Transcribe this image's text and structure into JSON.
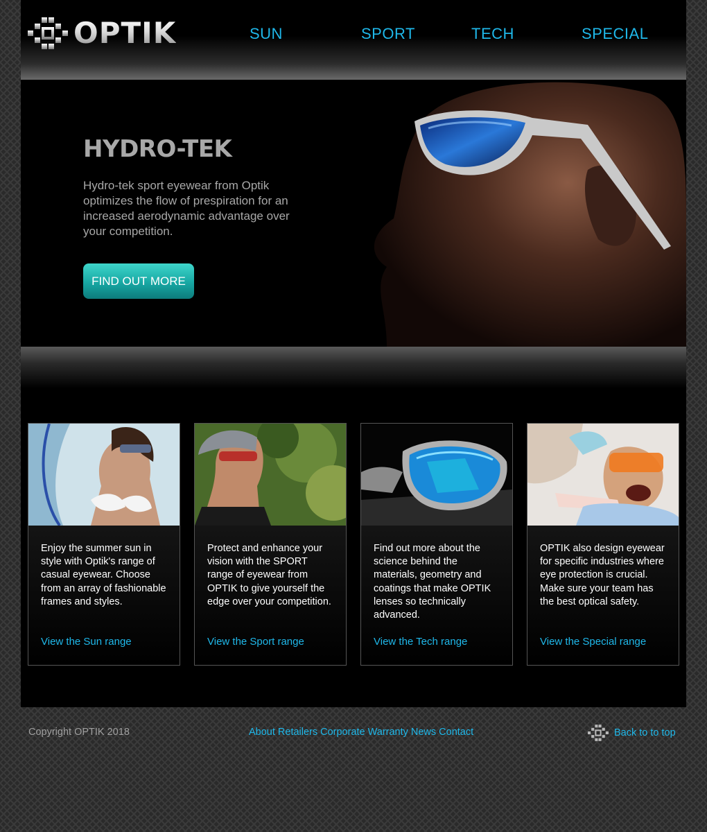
{
  "brand": {
    "name": "OPTIK",
    "logo_icon": "optik-logo-mark"
  },
  "nav": [
    {
      "label": "SUN"
    },
    {
      "label": "SPORT"
    },
    {
      "label": "TECH"
    },
    {
      "label": "SPECIAL"
    }
  ],
  "hero": {
    "title": "HYDRO-TEK",
    "text": "Hydro-tek sport eyewear from Optik optimizes the flow of prespiration for an increased aerodynamic advantage over your competition.",
    "button_label": "FIND OUT MORE"
  },
  "cards": [
    {
      "text": "Enjoy the summer sun in style with Optik's range of casual eyewear. Choose from an array of fashionable frames and styles.",
      "link": "View the Sun range"
    },
    {
      "text": "Protect  and enhance your vision with the SPORT range of eyewear from OPTIK to give yourself the edge over your competition.",
      "link": "View the Sport range"
    },
    {
      "text": "Find out more about the science behind the materials, geometry and coatings that make OPTIK lenses so technically advanced.",
      "link": "View the Tech range"
    },
    {
      "text": "OPTIK also design eyewear for specific industries where eye protection is crucial. Make sure your team has the best optical safety.",
      "link": "View the Special range"
    }
  ],
  "footer": {
    "copyright": "Copyright OPTIK 2018",
    "links": [
      "About",
      "Retailers",
      "Corporate",
      "Warranty",
      "News",
      "Contact"
    ],
    "back_to_top": "Back to to top"
  },
  "colors": {
    "accent": "#1fb8ea",
    "button": "#17a7a3",
    "background": "#000000",
    "muted_text": "#a8a8a8"
  }
}
